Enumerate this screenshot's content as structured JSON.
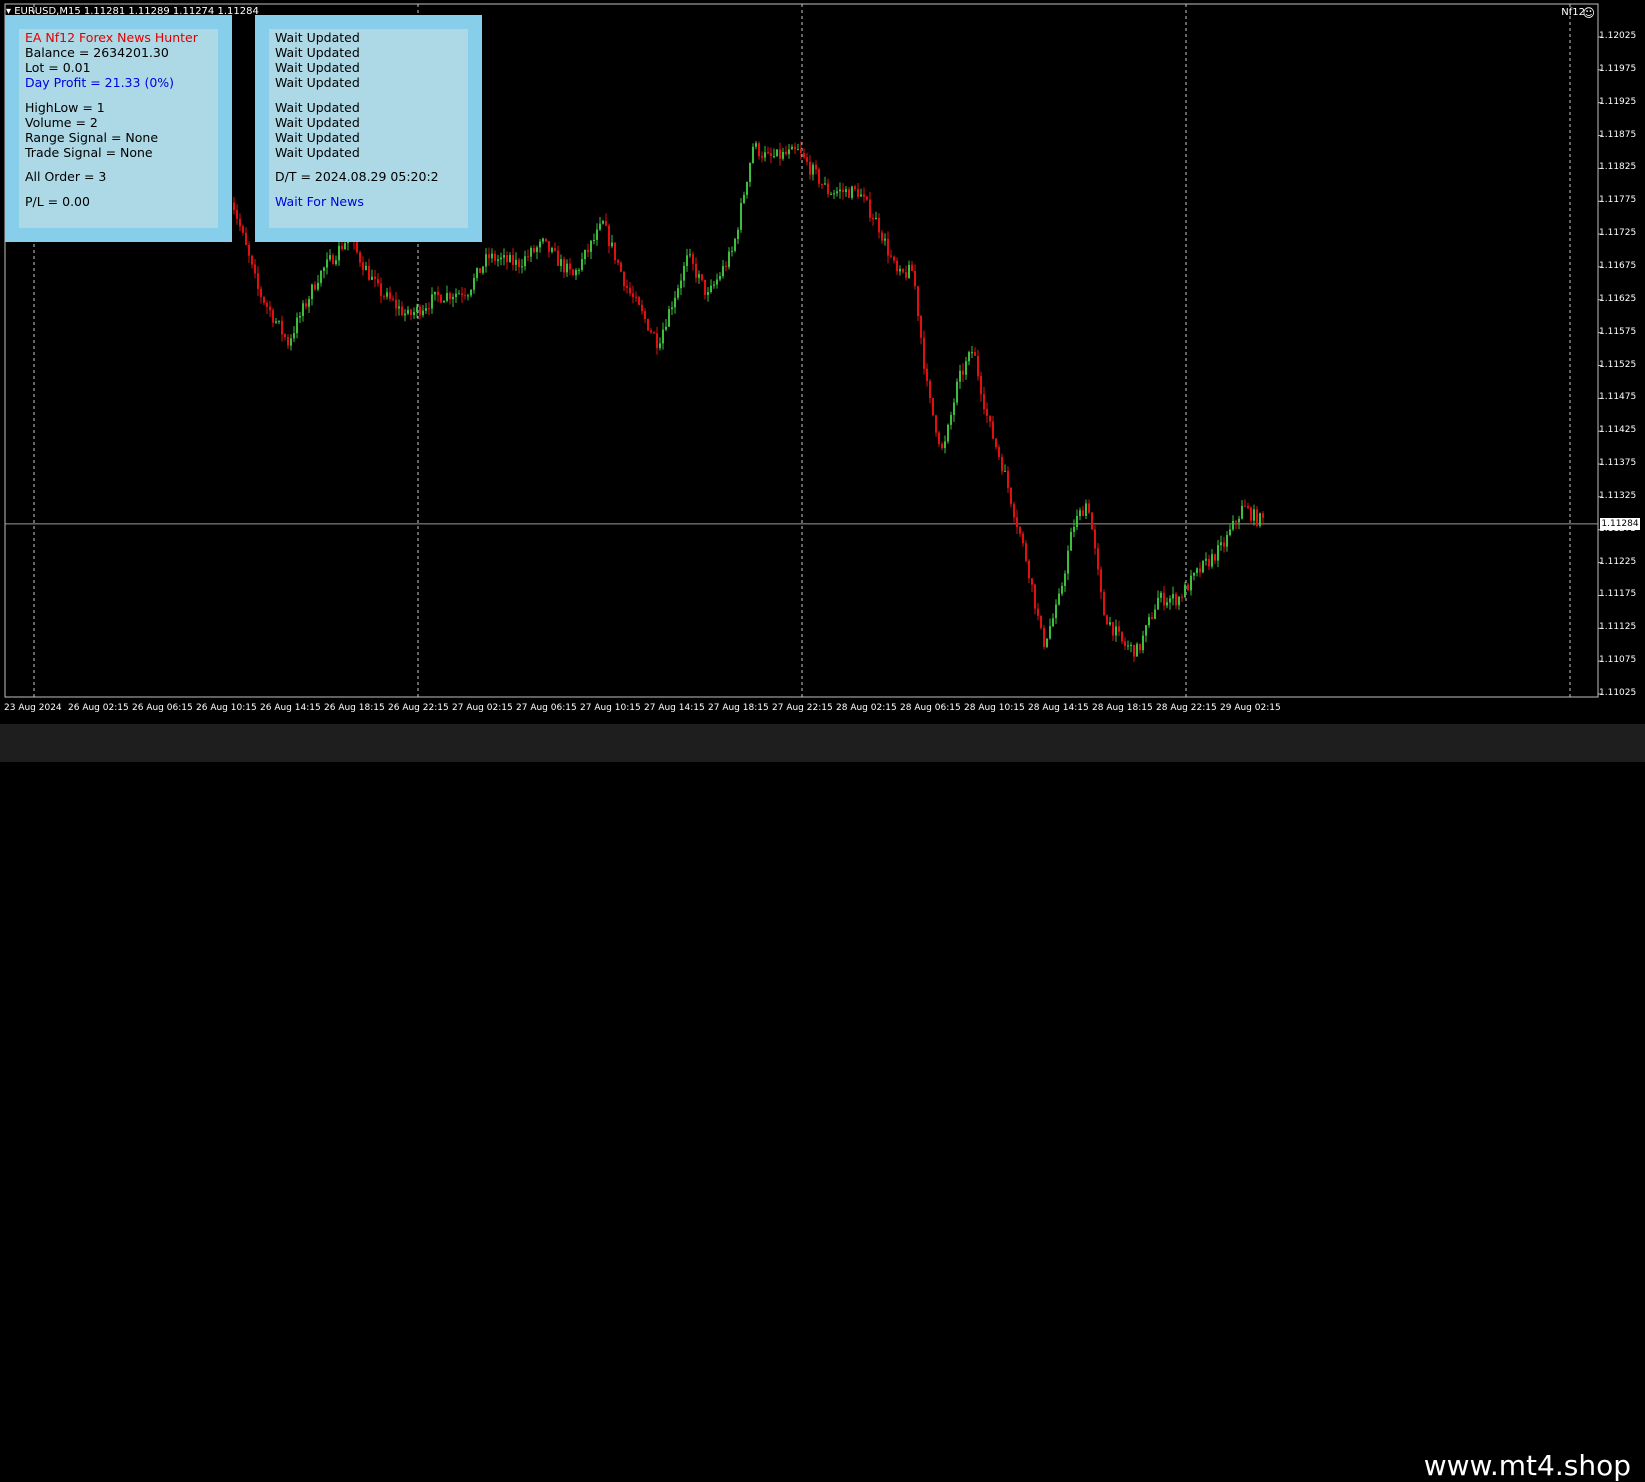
{
  "title_bar": "▾ EURUSD,M15  1.11281 1.11289 1.11274 1.11284",
  "corner_tag": "Nf12",
  "colors": {
    "background": "#000000",
    "bull_candle": "#3cbf3c",
    "bear_candle": "#e01010",
    "panel_border": "#87ceeb",
    "panel_fill": "#add8e6"
  },
  "panel_left": {
    "title": "EA Nf12 Forex News Hunter",
    "balance": "Balance = 2634201.30",
    "lot": "Lot = 0.01",
    "day_profit": "Day Profit = 21.33 (0%)",
    "highlow": "HighLow = 1",
    "volume": "Volume = 2",
    "range_signal": "Range Signal = None",
    "trade_signal": "Trade Signal = None",
    "all_order": "All Order = 3",
    "pl": "P/L = 0.00"
  },
  "panel_right": {
    "status_1": "Wait Updated",
    "status_2": "Wait Updated",
    "status_3": "Wait Updated",
    "status_4": "Wait Updated",
    "status_5": "Wait Updated",
    "status_6": "Wait Updated",
    "status_7": "Wait Updated",
    "status_8": "Wait Updated",
    "datetime": "D/T = 2024.08.29 05:20:2",
    "news_status": "Wait For News"
  },
  "price_axis": [
    "1.12025",
    "1.11975",
    "1.11925",
    "1.11875",
    "1.11825",
    "1.11775",
    "1.11725",
    "1.11675",
    "1.11625",
    "1.11575",
    "1.11525",
    "1.11475",
    "1.11425",
    "1.11375",
    "1.11325",
    "1.11275",
    "1.11225",
    "1.11175",
    "1.11125",
    "1.11075",
    "1.11025"
  ],
  "current_price": "1.11284",
  "time_axis": [
    "23 Aug 2024",
    "26 Aug 02:15",
    "26 Aug 06:15",
    "26 Aug 10:15",
    "26 Aug 14:15",
    "26 Aug 18:15",
    "26 Aug 22:15",
    "27 Aug 02:15",
    "27 Aug 06:15",
    "27 Aug 10:15",
    "27 Aug 14:15",
    "27 Aug 18:15",
    "27 Aug 22:15",
    "28 Aug 02:15",
    "28 Aug 06:15",
    "28 Aug 10:15",
    "28 Aug 14:15",
    "28 Aug 18:15",
    "28 Aug 22:15",
    "29 Aug 02:15"
  ],
  "watermark": "www.mt4.shop"
}
